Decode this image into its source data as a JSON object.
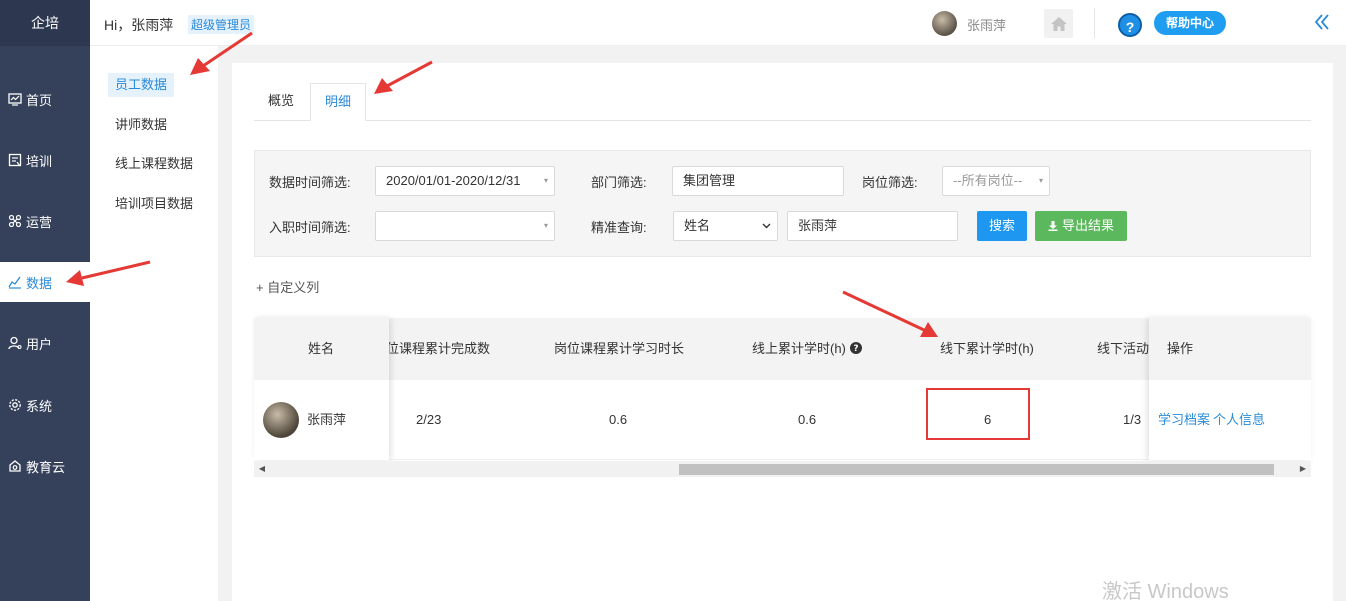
{
  "brand": "企培",
  "nav": {
    "items": [
      {
        "label": "首页",
        "icon": "dashboard-icon"
      },
      {
        "label": "培训",
        "icon": "training-icon"
      },
      {
        "label": "运营",
        "icon": "operations-icon"
      },
      {
        "label": "数据",
        "icon": "data-chart-icon",
        "active": true
      },
      {
        "label": "用户",
        "icon": "user-icon"
      },
      {
        "label": "系统",
        "icon": "gear-icon"
      },
      {
        "label": "教育云",
        "icon": "cloud-icon"
      }
    ]
  },
  "header": {
    "greeting": "Hi，张雨萍",
    "role": "超级管理员",
    "username": "张雨萍",
    "help_label": "帮助中心",
    "help_symbol": "?"
  },
  "submenu": {
    "items": [
      {
        "label": "员工数据",
        "active": true
      },
      {
        "label": "讲师数据"
      },
      {
        "label": "线上课程数据"
      },
      {
        "label": "培训项目数据"
      }
    ]
  },
  "tabs": [
    {
      "label": "概览"
    },
    {
      "label": "明细",
      "active": true
    }
  ],
  "filters": {
    "data_time_label": "数据时间筛选:",
    "data_time_value": "2020/01/01-2020/12/31",
    "dept_label": "部门筛选:",
    "dept_value": "集团管理",
    "post_label": "岗位筛选:",
    "post_placeholder": "--所有岗位--",
    "join_time_label": "入职时间筛选:",
    "join_time_value": "",
    "precise_label": "精准查询:",
    "precise_field": "姓名",
    "precise_value": "张雨萍",
    "search_label": "搜索",
    "export_label": "导出结果"
  },
  "custom_columns_label": "+ 自定义列",
  "table": {
    "columns": {
      "name": "姓名",
      "post_course_done": "位课程累计完成数",
      "post_course_hours": "岗位课程累计学习时长",
      "online_hours": "线上累计学时(h)",
      "offline_hours": "线下累计学时(h)",
      "offline_activity": "线下活动",
      "actions": "操作"
    },
    "rows": [
      {
        "name": "张雨萍",
        "post_course_done": "2/23",
        "post_course_hours": "0.6",
        "online_hours": "0.6",
        "offline_hours": "6",
        "offline_activity": "1/3",
        "action_archive": "学习档案",
        "action_profile": "个人信息"
      }
    ]
  },
  "watermark": "激活 Windows",
  "colors": {
    "nav_bg": "#35415a",
    "accent": "#2a8bd8",
    "search_btn": "#1e97f0",
    "export_btn": "#5cb85c",
    "annotation_red": "#e53935"
  }
}
